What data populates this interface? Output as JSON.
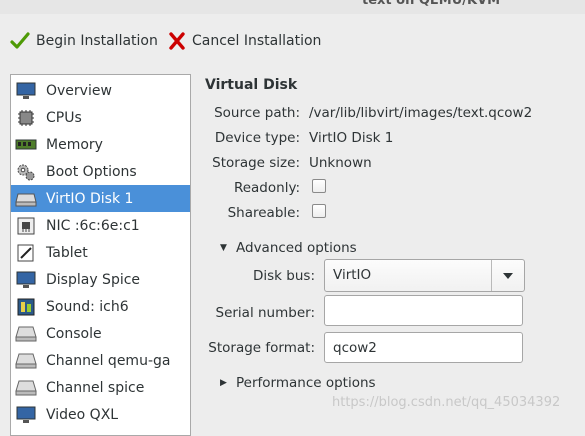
{
  "window": {
    "title": "text on QEMU/KVM"
  },
  "toolbar": {
    "begin_label": "Begin Installation",
    "cancel_label": "Cancel Installation"
  },
  "sidebar": {
    "items": [
      {
        "label": "Overview",
        "icon": "monitor-icon"
      },
      {
        "label": "CPUs",
        "icon": "cpu-icon"
      },
      {
        "label": "Memory",
        "icon": "memory-icon"
      },
      {
        "label": "Boot Options",
        "icon": "gears-icon"
      },
      {
        "label": "VirtIO Disk 1",
        "icon": "disk-icon",
        "selected": true
      },
      {
        "label": "NIC :6c:6e:c1",
        "icon": "nic-icon"
      },
      {
        "label": "Tablet",
        "icon": "tablet-icon"
      },
      {
        "label": "Display Spice",
        "icon": "display-icon"
      },
      {
        "label": "Sound: ich6",
        "icon": "sound-icon"
      },
      {
        "label": "Console",
        "icon": "console-icon"
      },
      {
        "label": "Channel qemu-ga",
        "icon": "channel-icon"
      },
      {
        "label": "Channel spice",
        "icon": "channel-icon"
      },
      {
        "label": "Video QXL",
        "icon": "video-icon"
      }
    ]
  },
  "details": {
    "heading": "Virtual Disk",
    "source_path_label": "Source path:",
    "source_path": "/var/lib/libvirt/images/text.qcow2",
    "device_type_label": "Device type:",
    "device_type": "VirtIO Disk 1",
    "storage_size_label": "Storage size:",
    "storage_size": "Unknown",
    "readonly_label": "Readonly:",
    "readonly": false,
    "shareable_label": "Shareable:",
    "shareable": false,
    "advanced_label": "Advanced options",
    "disk_bus_label": "Disk bus:",
    "disk_bus": "VirtIO",
    "serial_label": "Serial number:",
    "serial": "",
    "storage_format_label": "Storage format:",
    "storage_format": "qcow2",
    "performance_label": "Performance options"
  },
  "watermark": "https://blog.csdn.net/qq_45034392",
  "colors": {
    "selection": "#4a90d9",
    "check_green": "#4e9a06",
    "cancel_red": "#cc0000"
  }
}
